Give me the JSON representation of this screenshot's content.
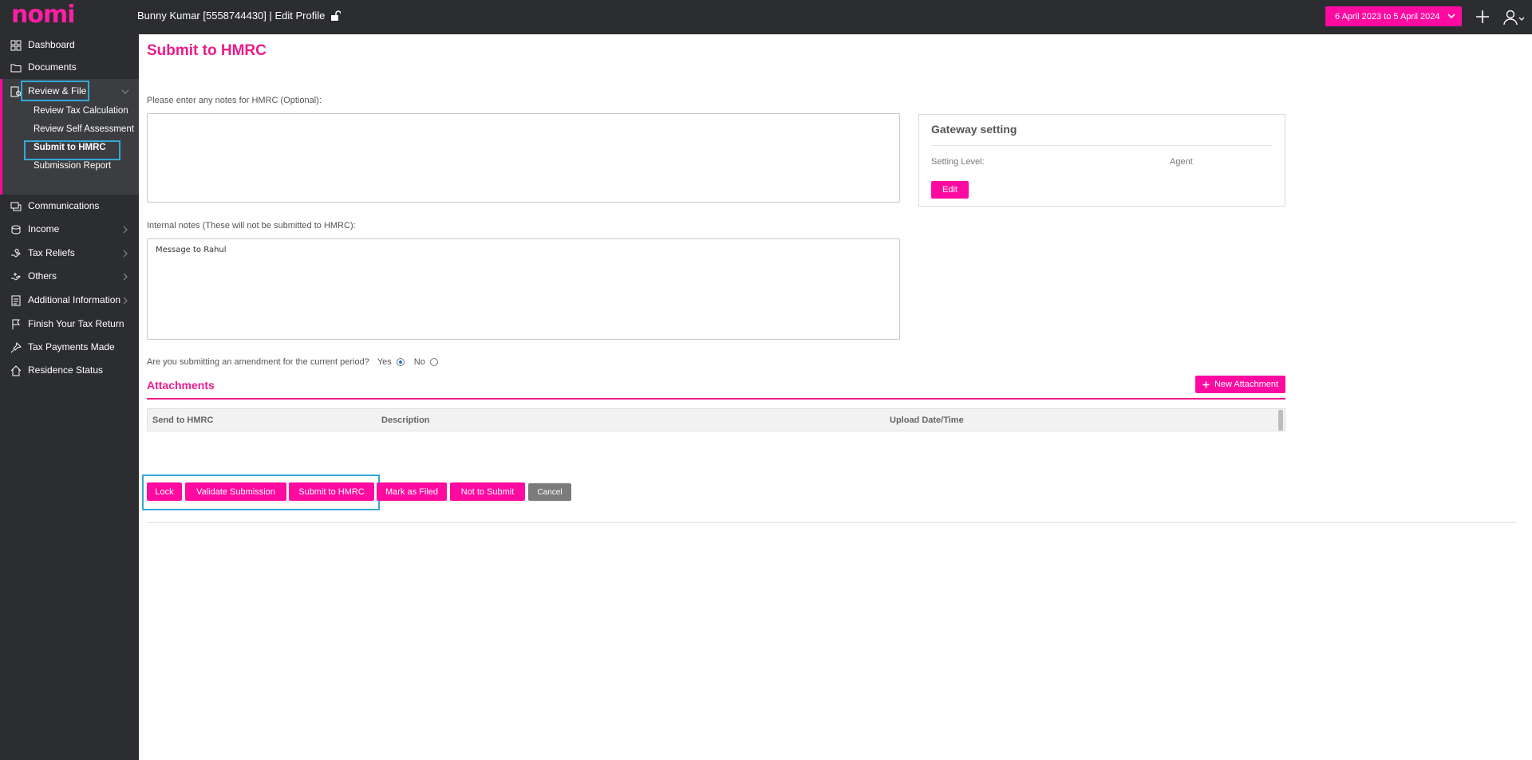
{
  "header": {
    "logo": "nomi",
    "user": "Bunny Kumar [5558744430] | Edit Profile",
    "date_range": "6 April 2023 to 5 April 2024"
  },
  "sidebar": {
    "items": [
      {
        "label": "Dashboard",
        "icon": "grid-icon"
      },
      {
        "label": "Documents",
        "icon": "folder-icon"
      },
      {
        "label": "Review & File",
        "icon": "review-icon"
      },
      {
        "label": "Communications",
        "icon": "chat-icon"
      },
      {
        "label": "Income",
        "icon": "coins-icon"
      },
      {
        "label": "Tax Reliefs",
        "icon": "relief-icon"
      },
      {
        "label": "Others",
        "icon": "others-icon"
      },
      {
        "label": "Additional Information",
        "icon": "info-doc-icon"
      },
      {
        "label": "Finish Your Tax Return",
        "icon": "flag-icon"
      },
      {
        "label": "Tax Payments Made",
        "icon": "pin-icon"
      },
      {
        "label": "Residence Status",
        "icon": "home-icon"
      }
    ],
    "sub_items": [
      "Review Tax Calculation",
      "Review Self Assessment",
      "Submit to HMRC",
      "Submission Report"
    ]
  },
  "main": {
    "title": "Submit to HMRC",
    "notes_label": "Please enter any notes for HMRC (Optional):",
    "notes_value": "",
    "internal_label": "Internal notes (These will not be submitted to HMRC):",
    "internal_value": "Message to Rahul",
    "gateway": {
      "title": "Gateway setting",
      "level_label": "Setting Level:",
      "level_value": "Agent",
      "edit_label": "Edit"
    },
    "amendment_question": "Are you submitting an amendment for the current period?",
    "yes_label": "Yes",
    "no_label": "No",
    "amendment_selected": "Yes",
    "attachments_title": "Attachments",
    "new_attachment_label": "New Attachment",
    "table_columns": [
      "Send to HMRC",
      "Description",
      "Upload Date/Time"
    ],
    "actions": [
      "Lock",
      "Validate Submission",
      "Submit to HMRC",
      "Mark as Filed",
      "Not to Submit",
      "Cancel"
    ]
  },
  "colors": {
    "accent": "#ff0aa0",
    "sidebar_bg": "#2c2d30",
    "highlight": "#35a8d6"
  }
}
